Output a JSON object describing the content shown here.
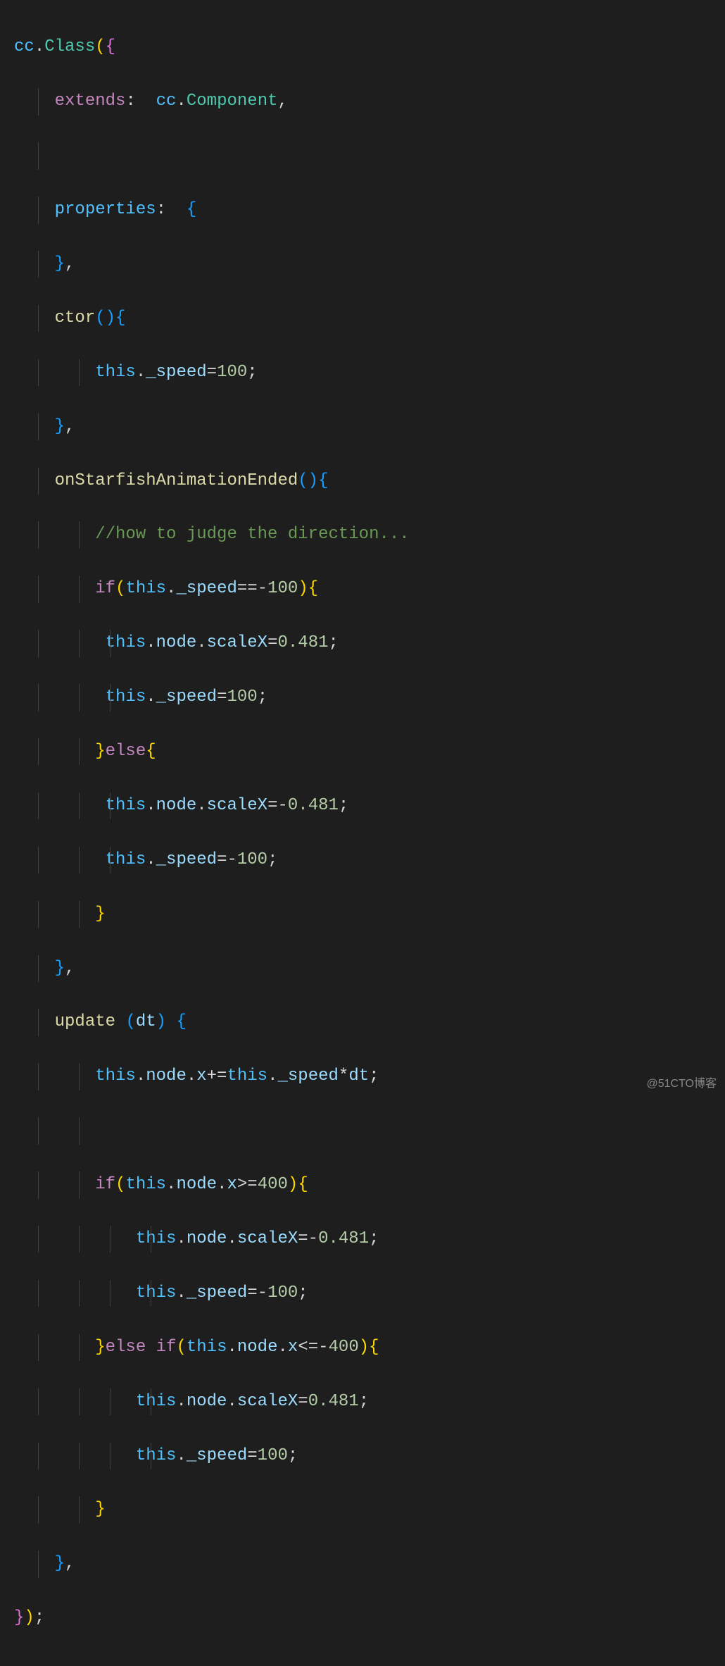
{
  "code": {
    "l1_a": "cc",
    "l1_b": ".",
    "l1_c": "Class",
    "l1_d": "(",
    "l1_e": "{",
    "l2_a": "extends",
    "l2_b": ":",
    "l2_c": "cc",
    "l2_d": ".",
    "l2_e": "Component",
    "l2_f": ",",
    "l3": "",
    "l4_a": "properties",
    "l4_b": ":",
    "l4_c": "{",
    "l5_a": "}",
    "l5_b": ",",
    "l6_a": "ctor",
    "l6_b": "(",
    "l6_c": ")",
    "l6_d": "{",
    "l7_a": "this",
    "l7_b": ".",
    "l7_c": "_speed",
    "l7_d": "=",
    "l7_e": "100",
    "l7_f": ";",
    "l8_a": "}",
    "l8_b": ",",
    "l9_a": "onStarfishAnimationEnded",
    "l9_b": "(",
    "l9_c": ")",
    "l9_d": "{",
    "l10_a": "//how to judge the direction...",
    "l11_a": "if",
    "l11_b": "(",
    "l11_c": "this",
    "l11_d": ".",
    "l11_e": "_speed",
    "l11_f": "==-",
    "l11_g": "100",
    "l11_h": ")",
    "l11_i": "{",
    "l12_a": "this",
    "l12_b": ".",
    "l12_c": "node",
    "l12_d": ".",
    "l12_e": "scaleX",
    "l12_f": "=",
    "l12_g": "0.481",
    "l12_h": ";",
    "l13_a": "this",
    "l13_b": ".",
    "l13_c": "_speed",
    "l13_d": "=",
    "l13_e": "100",
    "l13_f": ";",
    "l14_a": "}",
    "l14_b": "else",
    "l14_c": "{",
    "l15_a": "this",
    "l15_b": ".",
    "l15_c": "node",
    "l15_d": ".",
    "l15_e": "scaleX",
    "l15_f": "=-",
    "l15_g": "0.481",
    "l15_h": ";",
    "l16_a": "this",
    "l16_b": ".",
    "l16_c": "_speed",
    "l16_d": "=-",
    "l16_e": "100",
    "l16_f": ";",
    "l17_a": "}",
    "l18_a": "}",
    "l18_b": ",",
    "l19_a": "update",
    "l19_b": "(",
    "l19_c": "dt",
    "l19_d": ")",
    "l19_e": "{",
    "l20_a": "this",
    "l20_b": ".",
    "l20_c": "node",
    "l20_d": ".",
    "l20_e": "x",
    "l20_f": "+=",
    "l20_g": "this",
    "l20_h": ".",
    "l20_i": "_speed",
    "l20_j": "*",
    "l20_k": "dt",
    "l20_l": ";",
    "l21": "",
    "l22_a": "if",
    "l22_b": "(",
    "l22_c": "this",
    "l22_d": ".",
    "l22_e": "node",
    "l22_f": ".",
    "l22_g": "x",
    "l22_h": ">=",
    "l22_i": "400",
    "l22_j": ")",
    "l22_k": "{",
    "l23_a": "this",
    "l23_b": ".",
    "l23_c": "node",
    "l23_d": ".",
    "l23_e": "scaleX",
    "l23_f": "=-",
    "l23_g": "0.481",
    "l23_h": ";",
    "l24_a": "this",
    "l24_b": ".",
    "l24_c": "_speed",
    "l24_d": "=-",
    "l24_e": "100",
    "l24_f": ";",
    "l25_a": "}",
    "l25_b": "else",
    "l25_c": "if",
    "l25_d": "(",
    "l25_e": "this",
    "l25_f": ".",
    "l25_g": "node",
    "l25_h": ".",
    "l25_i": "x",
    "l25_j": "<=-",
    "l25_k": "400",
    "l25_l": ")",
    "l25_m": "{",
    "l26_a": "this",
    "l26_b": ".",
    "l26_c": "node",
    "l26_d": ".",
    "l26_e": "scaleX",
    "l26_f": "=",
    "l26_g": "0.481",
    "l26_h": ";",
    "l27_a": "this",
    "l27_b": ".",
    "l27_c": "_speed",
    "l27_d": "=",
    "l27_e": "100",
    "l27_f": ";",
    "l28_a": "}",
    "l29_a": "}",
    "l29_b": ",",
    "l30_a": "}",
    "l30_b": ")",
    "l30_c": ";"
  },
  "watermark": "@51CTO博客"
}
